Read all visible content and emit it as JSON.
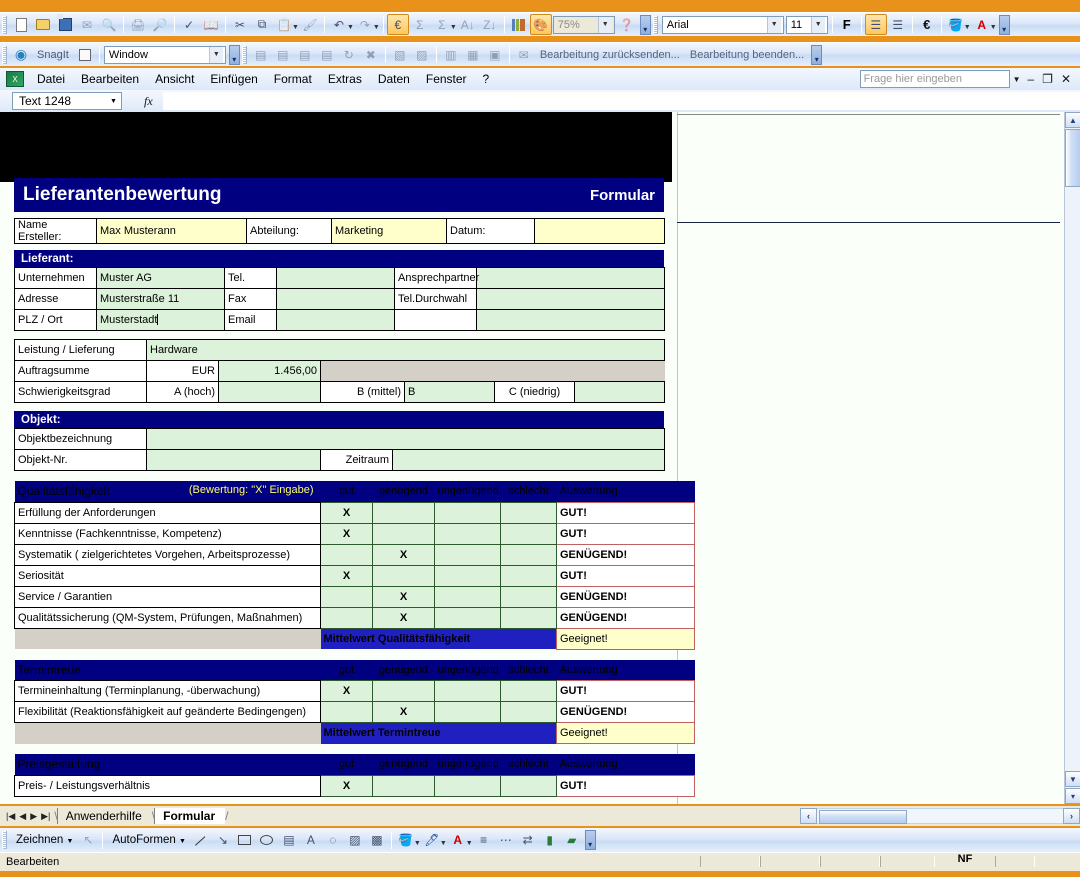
{
  "app": {
    "window_controls": [
      "–",
      "❐",
      "✕"
    ],
    "ask_placeholder": "Frage hier eingeben"
  },
  "toolbar_standard": {
    "zoom_value": "75%",
    "icons": [
      "new-document-icon",
      "open-folder-icon",
      "save-icon",
      "email-icon",
      "print-icon",
      "print-preview-icon",
      "spellcheck-icon",
      "research-icon",
      "cut-icon",
      "copy-icon",
      "paste-icon",
      "format-painter-icon",
      "undo-icon",
      "redo-icon",
      "insert-hyperlink-icon",
      "autosum-icon",
      "sort-ascending-icon",
      "sort-descending-icon",
      "chart-wizard-icon",
      "drawing-icon",
      "zoom-icon",
      "help-icon"
    ]
  },
  "toolbar_formatting": {
    "font_name": "Arial",
    "font_size": "11",
    "bold_label": "F",
    "icons": [
      "align-left-icon",
      "align-center-icon",
      "euro-currency-icon",
      "fill-color-icon",
      "font-color-icon"
    ]
  },
  "toolbar_snagit": {
    "label": "SnagIt",
    "capture_profile": "Window"
  },
  "toolbar_revision": {
    "send_back_label": "Bearbeitung zurücksenden...",
    "end_label": "Bearbeitung beenden..."
  },
  "menubar": {
    "items": [
      {
        "label": "Datei",
        "accel": "D"
      },
      {
        "label": "Bearbeiten",
        "accel": "B"
      },
      {
        "label": "Ansicht",
        "accel": "A"
      },
      {
        "label": "Einfügen",
        "accel": "E"
      },
      {
        "label": "Format",
        "accel": "t"
      },
      {
        "label": "Extras",
        "accel": "x"
      },
      {
        "label": "Daten",
        "accel": "n"
      },
      {
        "label": "Fenster",
        "accel": "F"
      },
      {
        "label": "?",
        "accel": "?"
      }
    ]
  },
  "formula_bar": {
    "name_box": "Text 1248",
    "formula_value": "",
    "fx_label": "fx"
  },
  "form": {
    "title": "Lieferantenbewertung",
    "title_right": "Formular",
    "creator": {
      "name_label": "Name Ersteller:",
      "name_value": "Max Musterann",
      "dept_label": "Abteilung:",
      "dept_value": "Marketing",
      "date_label": "Datum:",
      "date_value": ""
    },
    "supplier": {
      "heading": "Lieferant:",
      "rows": [
        {
          "label": "Unternehmen",
          "value": "Muster AG",
          "mid_label": "Tel.",
          "mid_value": "",
          "right_label": "Ansprechpartner",
          "right_value": ""
        },
        {
          "label": "Adresse",
          "value": "Musterstraße 11",
          "mid_label": "Fax",
          "mid_value": "",
          "right_label": "Tel.Durchwahl",
          "right_value": ""
        },
        {
          "label": "PLZ / Ort",
          "value": "Musterstadt",
          "mid_label": "Email",
          "mid_value": "",
          "right_label": "",
          "right_value": ""
        }
      ]
    },
    "order": {
      "service_label": "Leistung / Lieferung",
      "service_value": "Hardware",
      "sum_label": "Auftragsumme",
      "currency": "EUR",
      "sum_value": "1.456,00",
      "difficulty_label": "Schwierigkeitsgrad",
      "level_a": "A (hoch)",
      "level_a_value": "",
      "level_b": "B (mittel)",
      "level_b_value": "B",
      "level_c": "C (niedrig)",
      "level_c_value": ""
    },
    "object": {
      "heading": "Objekt:",
      "designation_label": "Objektbezeichnung",
      "designation_value": "",
      "number_label": "Objekt-Nr.",
      "number_value": "",
      "period_label": "Zeitraum",
      "period_value": ""
    },
    "rating_columns": [
      "gut",
      "genügend",
      "ungenügend",
      "schlecht"
    ],
    "eval_column": "Auswertung",
    "sections": [
      {
        "heading": "Qualitätsfähigkeit",
        "heading_note": "(Bewertung: \"X\" Eingabe)",
        "rows": [
          {
            "label": "Erfüllung der Anforderungen",
            "mark": 0,
            "eval": "GUT!"
          },
          {
            "label": "Kenntnisse (Fachkenntnisse, Kompetenz)",
            "mark": 0,
            "eval": "GUT!"
          },
          {
            "label": "Systematik ( zielgerichtetes Vorgehen, Arbeitsprozesse)",
            "mark": 1,
            "eval": "GENÜGEND!"
          },
          {
            "label": "Seriosität",
            "mark": 0,
            "eval": "GUT!"
          },
          {
            "label": "Service / Garantien",
            "mark": 1,
            "eval": "GENÜGEND!"
          },
          {
            "label": "Qualitätssicherung (QM-System, Prüfungen, Maßnahmen)",
            "mark": 1,
            "eval": "GENÜGEND!"
          }
        ],
        "average_label": "Mittelwert Qualitätsfähigkeit",
        "average_value": "Geeignet!"
      },
      {
        "heading": "Termintreue",
        "heading_note": "",
        "rows": [
          {
            "label": "Termineinhaltung (Terminplanung, -überwachung)",
            "mark": 0,
            "eval": "GUT!"
          },
          {
            "label": "Flexibilität (Reaktionsfähigkeit auf geänderte Bedingengen)",
            "mark": 1,
            "eval": "GENÜGEND!"
          }
        ],
        "average_label": "Mittelwert Termintreue",
        "average_value": "Geeignet!"
      },
      {
        "heading": "Preisgestaltung",
        "heading_note": "",
        "rows": [
          {
            "label": "Preis- / Leistungsverhältnis",
            "mark": 0,
            "eval": "GUT!"
          }
        ],
        "average_label": "",
        "average_value": ""
      }
    ],
    "mark_symbol": "X"
  },
  "sheet_tabs": {
    "nav": [
      "|◀",
      "◀",
      "▶",
      "▶|"
    ],
    "tabs": [
      {
        "label": "Anwenderhilfe",
        "active": false
      },
      {
        "label": "Formular",
        "active": true
      }
    ]
  },
  "drawing_toolbar": {
    "draw_label": "Zeichnen",
    "autoshapes_label": "AutoFormen",
    "icons": [
      "select-objects-icon",
      "line-icon",
      "arrow-icon",
      "rectangle-icon",
      "oval-icon",
      "text-box-icon",
      "wordart-icon",
      "diagram-icon",
      "clip-art-icon",
      "picture-icon",
      "fill-color-icon",
      "line-color-icon",
      "font-color-icon",
      "line-style-icon",
      "dash-style-icon",
      "arrow-style-icon",
      "shadow-style-icon",
      "3d-style-icon"
    ]
  },
  "status_bar": {
    "message": "Bearbeiten",
    "indicator": "NF"
  },
  "colors": {
    "accent_blue": "#000080",
    "form_green": "#ddf2da",
    "form_cream": "#ffffcc",
    "eval_red": "#cc0000",
    "mark_red": "#c0392b",
    "window_frame": "#e8921c"
  }
}
